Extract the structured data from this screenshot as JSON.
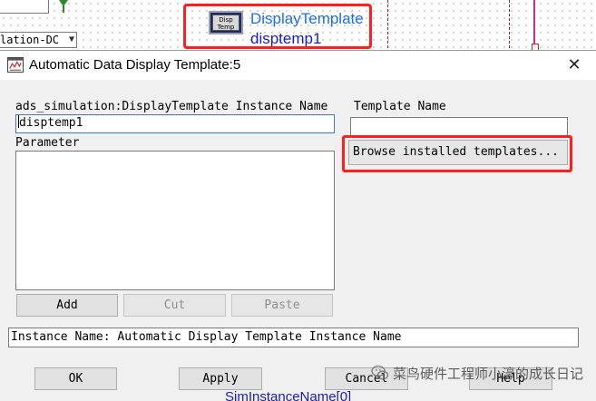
{
  "schematic": {
    "combo_value": "lation-DC",
    "component": {
      "symbol_line1": "Disp",
      "symbol_line2": "Temp",
      "name": "DisplayTemplate",
      "instance": "disptemp1"
    },
    "bottom_partial_text": "SimInstanceName[0]"
  },
  "dialog": {
    "title": "Automatic Data Display Template:5",
    "close_glyph": "✕",
    "instance_name_label": "ads_simulation:DisplayTemplate Instance Name",
    "instance_name_value": "disptemp1",
    "parameter_label": "Parameter",
    "template_name_label": "Template Name",
    "template_name_value": "",
    "browse_button": "Browse installed templates...",
    "add_button": "Add",
    "cut_button": "Cut",
    "paste_button": "Paste",
    "status_text": "Instance Name: Automatic Display Template Instance Name",
    "ok_button": "OK",
    "apply_button": "Apply",
    "cancel_button": "Cancel",
    "help_button": "Help"
  },
  "watermark": {
    "text": "菜鸟硬件工程师小濠的成长日记",
    "icon": "wechat-icon"
  },
  "colors": {
    "highlight_red": "#ff1f1f",
    "component_name_blue": "#1e6fe6",
    "instance_blue": "#1c1cb8"
  }
}
